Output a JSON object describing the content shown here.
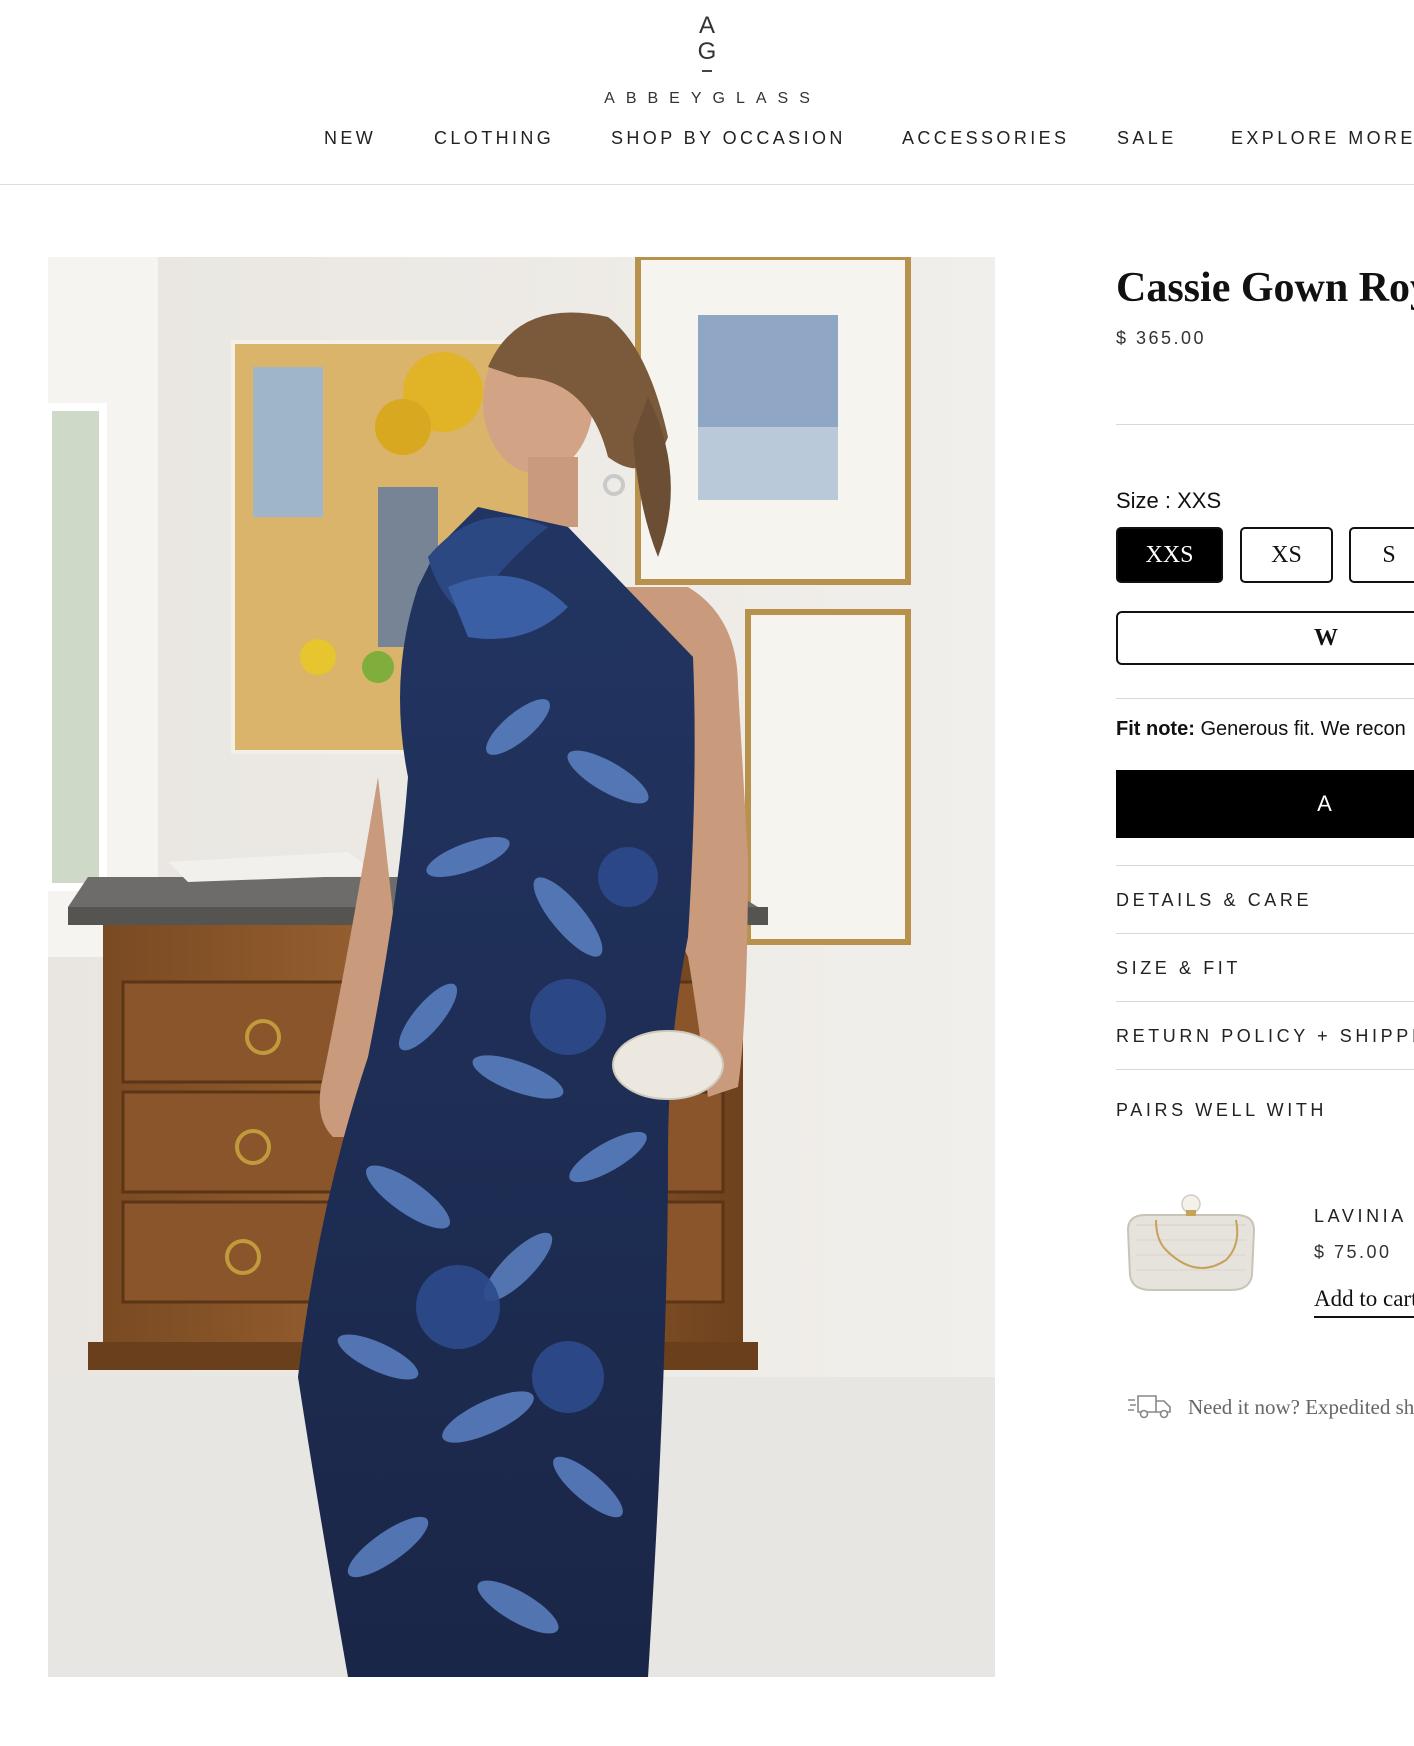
{
  "brand": {
    "monogram_top": "A",
    "monogram_bottom": "G",
    "wordmark": "ABBEYGLASS"
  },
  "nav": {
    "items": [
      "NEW",
      "CLOTHING",
      "SHOP BY OCCASION",
      "ACCESSORIES",
      "SALE",
      "EXPLORE MORE"
    ]
  },
  "product": {
    "title": "Cassie Gown Royal Organza",
    "price": "$ 365.00",
    "size_label": "Size : XXS",
    "sizes": [
      "XXS",
      "XS",
      "S"
    ],
    "selected_size": "XXS",
    "waitlist_label": "W",
    "fit_note_label": "Fit note:",
    "fit_note_text": "Generous fit. We recon",
    "add_to_cart_label": "A",
    "accordions": [
      "DETAILS & CARE",
      "SIZE & FIT",
      "RETURN POLICY + SHIPPING",
      "PAIRS WELL WITH"
    ]
  },
  "pairs": {
    "name": "LAVINIA",
    "price": "$ 75.00",
    "add_label": "Add to cart"
  },
  "shipping": {
    "text": "Need it now? Expedited sh"
  },
  "icons": [
    "truck-icon"
  ],
  "colors": {
    "accent": "#000000",
    "dress_dark": "#1b2747",
    "dress_light": "#5c82c4",
    "divider": "#d8d8d8"
  }
}
